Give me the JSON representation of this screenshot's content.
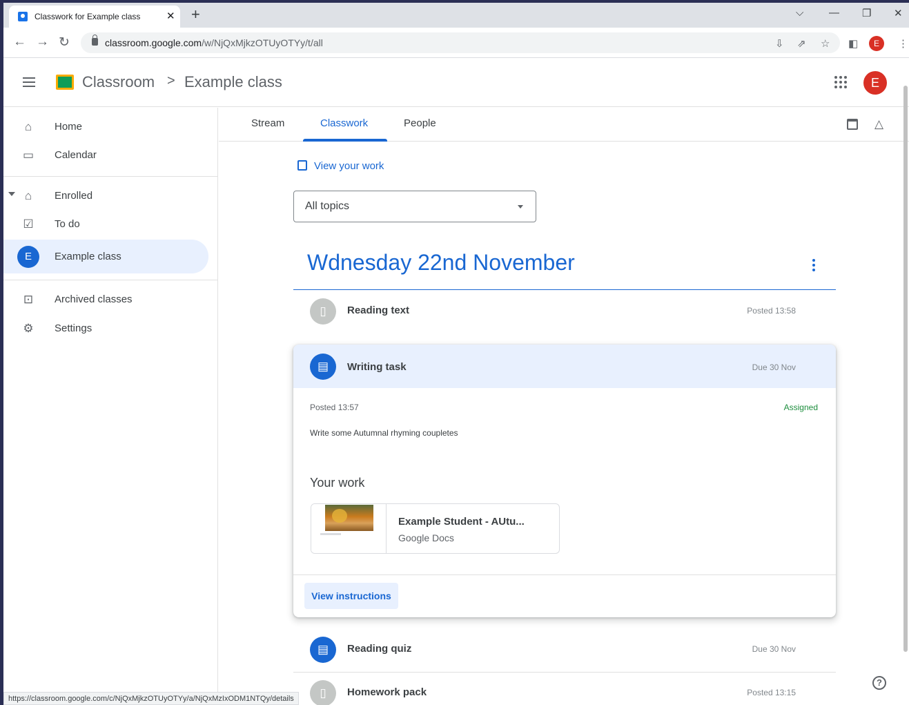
{
  "browser": {
    "tab_title": "Classwork for Example class",
    "url_host": "classroom.google.com",
    "url_path": "/w/NjQxMjkzOTUyOTYy/t/all",
    "profile_initial": "E",
    "status_url": "https://classroom.google.com/c/NjQxMjkzOTUyOTYy/a/NjQxMzIxODM1NTQy/details"
  },
  "header": {
    "brand": "Classroom",
    "separator": ">",
    "class_name": "Example class",
    "avatar_initial": "E"
  },
  "sidebar": {
    "items": [
      {
        "label": "Home",
        "icon": "home-icon"
      },
      {
        "label": "Calendar",
        "icon": "calendar-icon"
      },
      {
        "label": "Enrolled",
        "icon": "graduation-cap-icon"
      },
      {
        "label": "To do",
        "icon": "todo-list-icon"
      },
      {
        "label": "Example class",
        "initial": "E",
        "active": true
      },
      {
        "label": "Archived classes",
        "icon": "archive-icon"
      },
      {
        "label": "Settings",
        "icon": "gear-icon"
      }
    ]
  },
  "tabs": [
    {
      "label": "Stream"
    },
    {
      "label": "Classwork",
      "selected": true
    },
    {
      "label": "People"
    }
  ],
  "view_your_work": "View your work",
  "topic_filter": {
    "selected": "All topics"
  },
  "section": {
    "title": "Wdnesday 22nd November"
  },
  "items": [
    {
      "title": "Reading text",
      "meta": "Posted 13:58",
      "type": "material"
    },
    {
      "title": "Writing task",
      "meta": "Due 30 Nov",
      "type": "assignment",
      "expanded": true
    },
    {
      "title": "Reading quiz",
      "meta": "Due 30 Nov",
      "type": "assignment"
    },
    {
      "title": "Homework pack",
      "meta": "Posted 13:15",
      "type": "material"
    }
  ],
  "expanded": {
    "posted": "Posted 13:57",
    "status": "Assigned",
    "description": "Write some Autumnal rhyming coupletes",
    "your_work_heading": "Your work",
    "attachment": {
      "name": "Example Student - AUtu...",
      "type": "Google Docs"
    },
    "view_instructions": "View instructions"
  },
  "colors": {
    "accent": "#1967d2",
    "assigned": "#1e8e3e",
    "avatar": "#d93025"
  }
}
